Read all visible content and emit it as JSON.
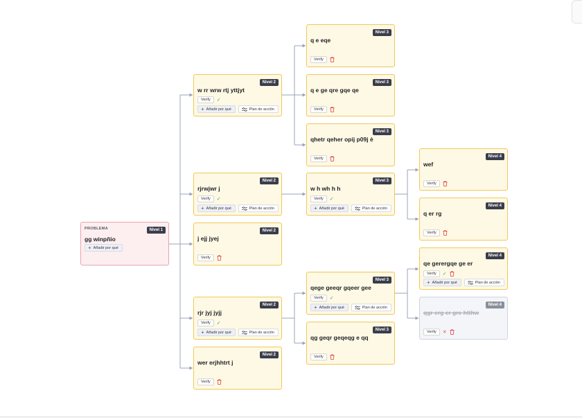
{
  "labels": {
    "problem": "PROBLEMA",
    "verify": "Verify",
    "add_why": "Añadir por qué",
    "action_plan": "Plan de acción"
  },
  "nodes": {
    "root": {
      "level": "Nivel 1",
      "title": "gg winpñio"
    },
    "n2a": {
      "level": "Nivel 2",
      "title": "w rr wrw rtj yttjyt"
    },
    "n2b": {
      "level": "Nivel 2",
      "title": "rjrwjwr j"
    },
    "n2c": {
      "level": "Nivel 2",
      "title": "j ejj jyej"
    },
    "n2d": {
      "level": "Nivel 2",
      "title": "rjr jyj jyjj"
    },
    "n2e": {
      "level": "Nivel 2",
      "title": "wer erjhhtrt j"
    },
    "n3a": {
      "level": "Nivel 3",
      "title": "q e eqe"
    },
    "n3b": {
      "level": "Nivel 3",
      "title": "q e ge qre gqe qe"
    },
    "n3c": {
      "level": "Nivel 3",
      "title": "qhetr qeher opij p09j è"
    },
    "n3d": {
      "level": "Nivel 3",
      "title": "w h wh h h"
    },
    "n3e": {
      "level": "Nivel 3",
      "title": "qege geeqr gqeer gee"
    },
    "n3f": {
      "level": "Nivel 3",
      "title": "qg geqr geqeqg e qq"
    },
    "n4a": {
      "level": "Nivel 4",
      "title": "wef"
    },
    "n4b": {
      "level": "Nivel 4",
      "title": "q er rg"
    },
    "n4c": {
      "level": "Nivel 4",
      "title": "qe gerergqe ge er"
    },
    "n4d": {
      "level": "Nivel 4",
      "title": "qgr erg er gre htthw"
    }
  },
  "colors": {
    "node_bg": "#fef9e4",
    "node_border": "#f0c75a",
    "root_bg": "#fdeef0",
    "root_border": "#e8a4ac",
    "struck_bg": "#f3f5f8",
    "badge_bg": "#3a3d4a",
    "connector": "#9aa3b8",
    "check": "#3aa55b",
    "delete": "#e05555"
  }
}
